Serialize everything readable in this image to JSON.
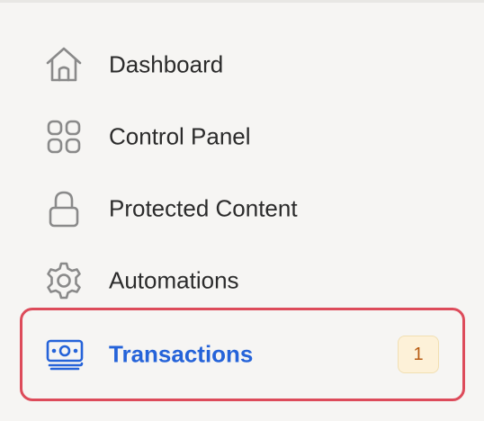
{
  "sidebar": {
    "items": [
      {
        "label": "Dashboard",
        "icon": "home-icon"
      },
      {
        "label": "Control Panel",
        "icon": "grid-icon"
      },
      {
        "label": "Protected Content",
        "icon": "lock-icon"
      },
      {
        "label": "Automations",
        "icon": "gear-icon"
      },
      {
        "label": "Transactions",
        "icon": "banknote-icon",
        "badge": "1",
        "active": true
      }
    ]
  },
  "colors": {
    "background": "#f6f5f3",
    "text": "#2b2b2b",
    "icon": "#8a8a8a",
    "active_text": "#2563d9",
    "highlight_border": "#dd4b5a",
    "badge_bg": "#fdf1d8",
    "badge_text": "#b85c13"
  }
}
